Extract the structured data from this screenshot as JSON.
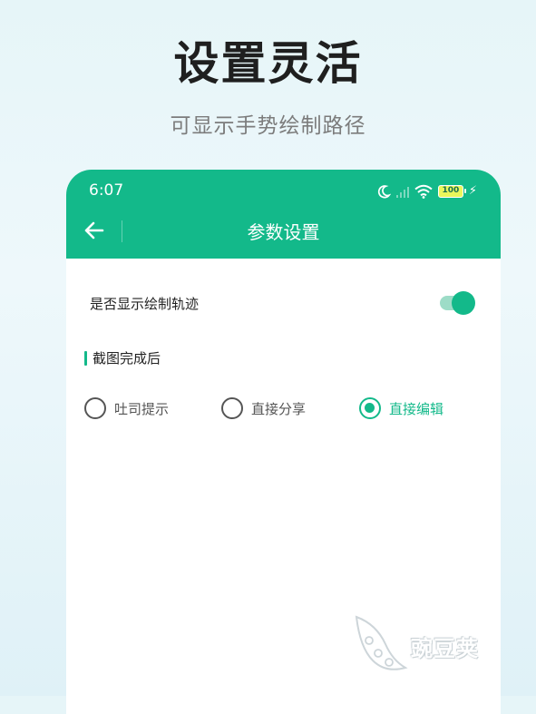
{
  "promo": {
    "title": "设置灵活",
    "subtitle": "可显示手势绘制路径"
  },
  "status_bar": {
    "time": "6:07",
    "battery": "100",
    "icons": [
      "moon-icon",
      "signal-icon",
      "wifi-icon",
      "battery-icon",
      "charging-icon"
    ]
  },
  "app_bar": {
    "title": "参数设置",
    "back_icon": "arrow-left-icon"
  },
  "settings": {
    "show_trace": {
      "label": "是否显示绘制轨迹",
      "enabled": true
    },
    "after_screenshot": {
      "title": "截图完成后",
      "options": [
        {
          "label": "吐司提示",
          "selected": false
        },
        {
          "label": "直接分享",
          "selected": false
        },
        {
          "label": "直接编辑",
          "selected": true
        }
      ]
    }
  },
  "watermark": {
    "text": "豌豆荚"
  },
  "colors": {
    "accent": "#13b98a",
    "toggle_track": "#9ddcc7",
    "background": "#e6f5f8"
  }
}
